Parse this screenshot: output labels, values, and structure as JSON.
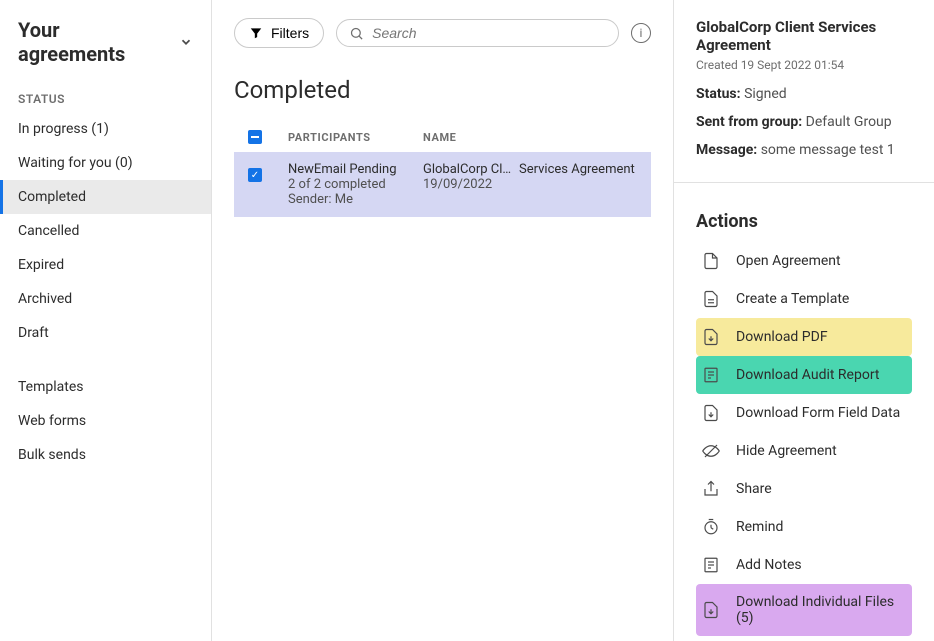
{
  "page": {
    "title": "Your agreements"
  },
  "sidebar": {
    "status_label": "STATUS",
    "items": [
      {
        "label": "In progress (1)"
      },
      {
        "label": "Waiting for you (0)"
      },
      {
        "label": "Completed"
      },
      {
        "label": "Cancelled"
      },
      {
        "label": "Expired"
      },
      {
        "label": "Archived"
      },
      {
        "label": "Draft"
      }
    ],
    "secondary": [
      {
        "label": "Templates"
      },
      {
        "label": "Web forms"
      },
      {
        "label": "Bulk sends"
      }
    ]
  },
  "toolbar": {
    "filters_label": "Filters",
    "search_placeholder": "Search"
  },
  "main": {
    "heading": "Completed",
    "columns": {
      "participants": "PARTICIPANTS",
      "name": "NAME"
    },
    "rows": [
      {
        "participants_line1": "NewEmail Pending",
        "participants_line2": "2 of 2 completed",
        "participants_line3": "Sender: Me",
        "name_part1": "GlobalCorp Cli...",
        "name_part2": "Services Agreement",
        "date": "19/09/2022"
      }
    ]
  },
  "details": {
    "title": "GlobalCorp Client Services Agreement",
    "created": "Created 19 Sept 2022 01:54",
    "status_label": "Status:",
    "status_value": "Signed",
    "sent_label": "Sent from group:",
    "sent_value": "Default Group",
    "message_label": "Message:",
    "message_value": "some message test 1",
    "actions_header": "Actions",
    "actions": [
      {
        "label": "Open Agreement"
      },
      {
        "label": "Create a Template"
      },
      {
        "label": "Download PDF"
      },
      {
        "label": "Download Audit Report"
      },
      {
        "label": "Download Form Field Data"
      },
      {
        "label": "Hide Agreement"
      },
      {
        "label": "Share"
      },
      {
        "label": "Remind"
      },
      {
        "label": "Add Notes"
      },
      {
        "label": "Download Individual Files (5)"
      }
    ]
  }
}
